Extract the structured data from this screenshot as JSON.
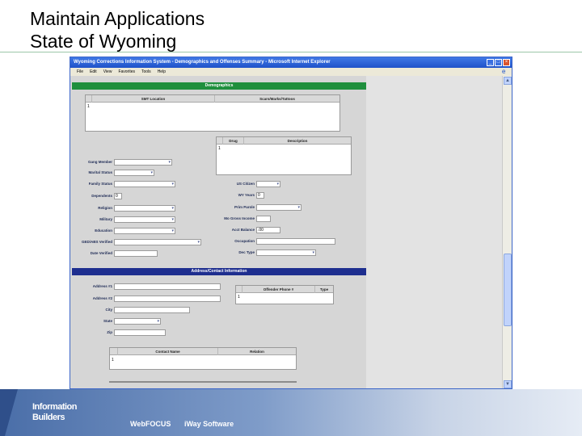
{
  "slide": {
    "title_line1": "Maintain Applications",
    "title_line2": "State of Wyoming"
  },
  "window": {
    "title": "Wyoming Corrections Information System - Demographics and Offenses Summary - Microsoft Internet Explorer",
    "menu": [
      "File",
      "Edit",
      "View",
      "Favorites",
      "Tools",
      "Help"
    ]
  },
  "demographics": {
    "header": "Demographics",
    "smt_grid": {
      "columns": [
        "SMT Location",
        "Scars/Marks/Tattoos"
      ],
      "rows": [
        [
          "1",
          "",
          ""
        ]
      ]
    },
    "drug_grid": {
      "columns": [
        "Drug",
        "Description"
      ],
      "rows": [
        [
          "1",
          "",
          ""
        ]
      ]
    },
    "left_fields": [
      {
        "label": "Gang Member",
        "type": "select",
        "value": ""
      },
      {
        "label": "Marital Status",
        "type": "select",
        "value": ""
      },
      {
        "label": "Family Status",
        "type": "select",
        "value": ""
      },
      {
        "label": "Dependents",
        "type": "input",
        "value": "0"
      },
      {
        "label": "Religion",
        "type": "select",
        "value": ""
      },
      {
        "label": "Military",
        "type": "select",
        "value": ""
      },
      {
        "label": "Education",
        "type": "select",
        "value": ""
      },
      {
        "label": "GED/ABS Verified",
        "type": "select",
        "value": ""
      },
      {
        "label": "Date Verified",
        "type": "input",
        "value": ""
      }
    ],
    "right_fields": [
      {
        "label": "US Citizen",
        "type": "select",
        "value": ""
      },
      {
        "label": "WY Years",
        "type": "input",
        "value": "0"
      },
      {
        "label": "Prim Parole",
        "type": "select",
        "value": ""
      },
      {
        "label": "Mo Gross Income",
        "type": "input",
        "value": ""
      },
      {
        "label": "Acct Balance",
        "type": "input",
        "value": ".00"
      },
      {
        "label": "Occupation",
        "type": "input",
        "value": ""
      },
      {
        "label": "Dec Type",
        "type": "select",
        "value": ""
      }
    ]
  },
  "address": {
    "header": "Address/Contact Information",
    "fields": [
      {
        "label": "Address #1",
        "type": "input",
        "value": ""
      },
      {
        "label": "Address #2",
        "type": "input",
        "value": ""
      },
      {
        "label": "City",
        "type": "input",
        "value": ""
      },
      {
        "label": "State",
        "type": "select",
        "value": ""
      },
      {
        "label": "Zip",
        "type": "input",
        "value": ""
      }
    ],
    "phone_grid": {
      "columns": [
        "Offender Phone #",
        "Type"
      ],
      "rows": [
        [
          "1",
          "",
          ""
        ]
      ]
    },
    "contact_grid": {
      "columns": [
        "Contact Name",
        "Relation"
      ],
      "rows": [
        [
          "1",
          "",
          ""
        ]
      ]
    }
  },
  "footer": {
    "brand_line1": "Information",
    "brand_line2": "Builders",
    "products": [
      "WebFOCUS",
      "iWay Software"
    ]
  },
  "colors": {
    "green_band": "#1f8f3d",
    "blue_band": "#1e2e8f",
    "titlebar": "#1f52c9",
    "footer": "#4a6ea8"
  }
}
